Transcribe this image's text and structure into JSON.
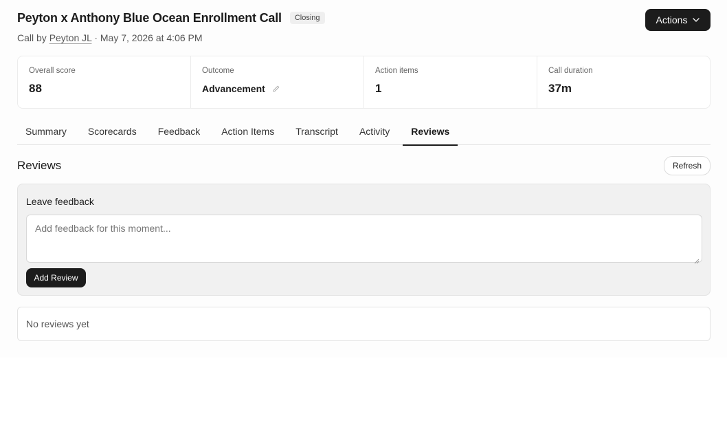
{
  "header": {
    "title": "Peyton x Anthony Blue Ocean Enrollment Call",
    "badge": "Closing",
    "call_by_prefix": "Call by",
    "author": "Peyton JL",
    "separator": "·",
    "date": "May 7, 2026 at 4:06 PM",
    "actions_label": "Actions"
  },
  "stats": [
    {
      "label": "Overall score",
      "value": "88"
    },
    {
      "label": "Outcome",
      "value": "Advancement"
    },
    {
      "label": "Action items",
      "value": "1"
    },
    {
      "label": "Call duration",
      "value": "37m"
    }
  ],
  "tabs": [
    {
      "label": "Summary",
      "active": false
    },
    {
      "label": "Scorecards",
      "active": false
    },
    {
      "label": "Feedback",
      "active": false
    },
    {
      "label": "Action Items",
      "active": false
    },
    {
      "label": "Transcript",
      "active": false
    },
    {
      "label": "Activity",
      "active": false
    },
    {
      "label": "Reviews",
      "active": true
    }
  ],
  "reviews": {
    "title": "Reviews",
    "refresh_label": "Refresh",
    "leave_feedback_label": "Leave feedback",
    "input_value": "",
    "input_placeholder": "Add feedback for this moment...",
    "add_review_label": "Add Review",
    "empty_text": "No reviews yet"
  },
  "icons": {
    "actions_chevron": "chevron-down-icon",
    "outcome_edit": "pencil-icon",
    "textarea_resize": "resize-grip-icon"
  },
  "colors": {
    "primary_button": "#1c1c1c",
    "badge_bg": "#efefef",
    "card_bg": "#f1f1f1",
    "border": "#e3e3e3"
  }
}
